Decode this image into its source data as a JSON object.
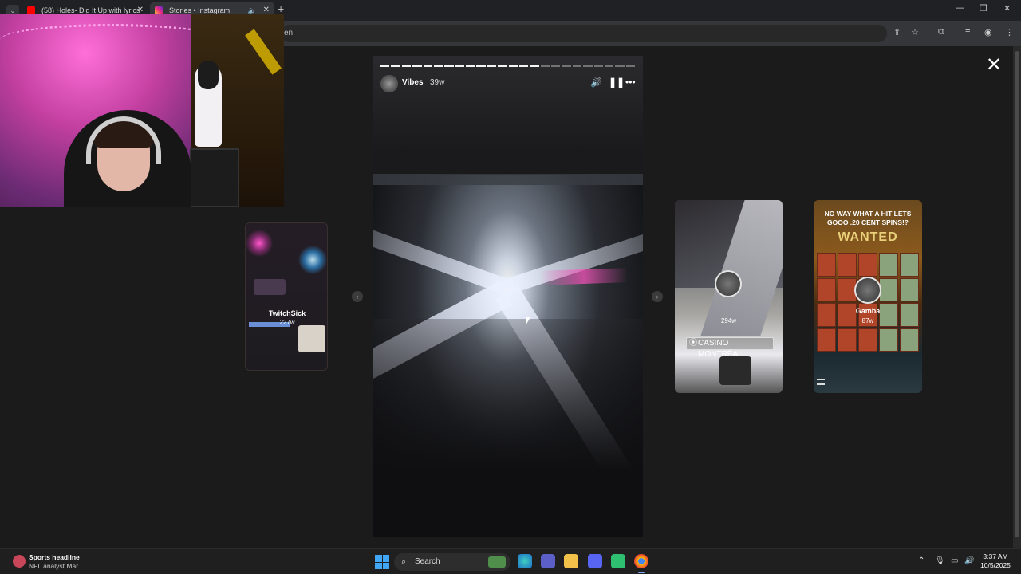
{
  "browser": {
    "tabs": [
      {
        "label": "(58) Holes- Dig It Up with lyrics",
        "favicon": "youtube-icon"
      },
      {
        "label": "Stories • Instagram",
        "favicon": "instagram-icon"
      }
    ],
    "address_fragment": "en"
  },
  "story": {
    "username": "Vibes",
    "age": "39w",
    "segments_total": 24,
    "segments_done": 15,
    "controls": [
      "volume-icon",
      "pause-icon",
      "more-icon"
    ]
  },
  "previews": {
    "left": {
      "name": "TwitchSick",
      "age": "227w"
    },
    "right1": {
      "name": "",
      "age": "294w",
      "location": "CASINO MONTRÉAL"
    },
    "right2": {
      "title": "NO WAY WHAT A HIT LETS GOOO .20 CENT SPINS!?",
      "banner": "WANTED",
      "name": "Gamba",
      "age": "87w"
    }
  },
  "taskbar": {
    "news_headline": "Sports headline",
    "news_sub": "NFL analyst Mar...",
    "search_label": "Search",
    "time": "3:37 AM",
    "date": "10/5/2025"
  },
  "colors": {
    "accent_blue": "#3fa7f5",
    "youtube_red": "#ff0000",
    "instagram_pink": "#e1306c"
  }
}
